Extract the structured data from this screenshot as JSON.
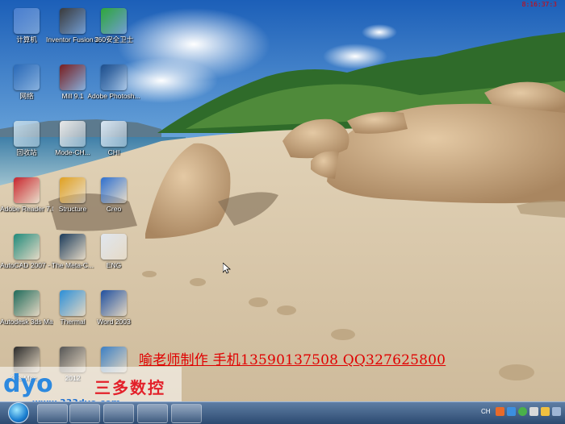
{
  "desktop": {
    "top_clock": "8:16:37:3",
    "icons": [
      {
        "label": "计算机",
        "icon": "computer-icon"
      },
      {
        "label": "Inventor Fusion 2012",
        "icon": "inventor-fusion-icon"
      },
      {
        "label": "360安全卫士",
        "icon": "360-safe-icon"
      },
      {
        "label": "网络",
        "icon": "network-icon"
      },
      {
        "label": "Mill 9.1",
        "icon": "mill-icon"
      },
      {
        "label": "Adobe Photosh...",
        "icon": "photoshop-icon"
      },
      {
        "label": "回收站",
        "icon": "recycle-bin-icon"
      },
      {
        "label": "Mode-CH...",
        "icon": "mode-ch-icon"
      },
      {
        "label": "CHI",
        "icon": "chi-icon"
      },
      {
        "label": "Adobe Reader 7.0",
        "icon": "adobe-reader-icon"
      },
      {
        "label": "Structure",
        "icon": "structure-icon"
      },
      {
        "label": "Creo",
        "icon": "creo-icon"
      },
      {
        "label": "AutoCAD 2007 - S...",
        "icon": "autocad-icon"
      },
      {
        "label": "The Meta-C...",
        "icon": "meta-icon"
      },
      {
        "label": "ENG",
        "icon": "eng-icon"
      },
      {
        "label": "Autodesk 3ds Max...",
        "icon": "3dsmax-icon"
      },
      {
        "label": "Thermal",
        "icon": "thermal-icon"
      },
      {
        "label": "Word 2003",
        "icon": "word-icon"
      },
      {
        "label": "3ds Max...",
        "icon": "3dsmax-2-icon"
      },
      {
        "label": "2012",
        "icon": "app-2012-icon"
      },
      {
        "label": "",
        "icon": "swift-icon"
      }
    ]
  },
  "banner": {
    "text": "喻老师制作 手机13590137508 QQ327625800"
  },
  "watermark": {
    "logo": "dyo",
    "brand": "三多数控",
    "url": "www.333dyo.com"
  },
  "taskbar": {
    "lang": "CH"
  },
  "colors": {
    "banner": "#e00000",
    "taskbar": "#2c4a70",
    "brand_red": "#e3202a",
    "brand_blue": "#2d89df"
  }
}
